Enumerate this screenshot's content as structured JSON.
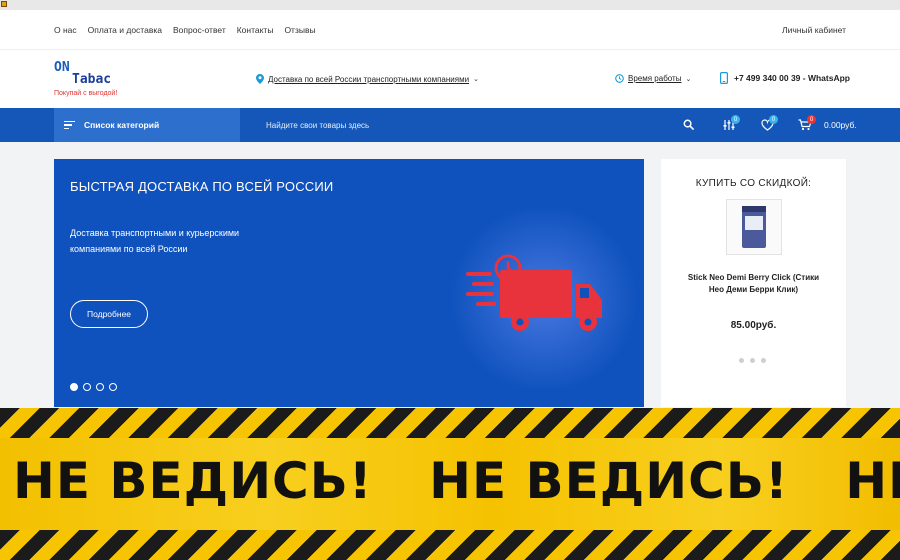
{
  "top_nav": {
    "items": [
      "О нас",
      "Оплата и доставка",
      "Вопрос-ответ",
      "Контакты",
      "Отзывы"
    ],
    "cabinet": "Личный кабинет"
  },
  "header": {
    "logo_on": "ON",
    "logo_tabac": "Tabac",
    "slogan": "Покупай с выгодой!",
    "delivery": "Доставка по всей России транспортными компаниями",
    "hours": "Время работы",
    "phone": "+7 499 340 00 39 - WhatsApp"
  },
  "navbar": {
    "categories": "Список категорий",
    "search_placeholder": "Найдите свои товары здесь",
    "compare_count": "0",
    "wishlist_count": "0",
    "cart_count": "0",
    "cart_total": "0.00руб."
  },
  "banner": {
    "title": "БЫСТРАЯ ДОСТАВКА ПО ВСЕЙ РОССИИ",
    "subtitle": "Доставка транспортными и курьерскими компаниями по всей России",
    "button": "Подробнее",
    "slides": 4,
    "active_slide": 1
  },
  "sidebar": {
    "title": "КУПИТЬ СО СКИДКОЙ:",
    "product_name": "Stick Neo Demi Berry Click (Стики Нео Деми Берри Клик)",
    "price": "85.00руб.",
    "slides": 3
  },
  "tape": {
    "text": [
      "НЕ ВЕДИСЬ!",
      "НЕ ВЕДИСЬ!",
      "НЕ ВЕДИСЬ!"
    ]
  },
  "colors": {
    "brand_blue": "#1557b8",
    "banner_blue": "#0f52bd",
    "truck_red": "#e8323c",
    "tape_yellow": "#f6c400"
  }
}
